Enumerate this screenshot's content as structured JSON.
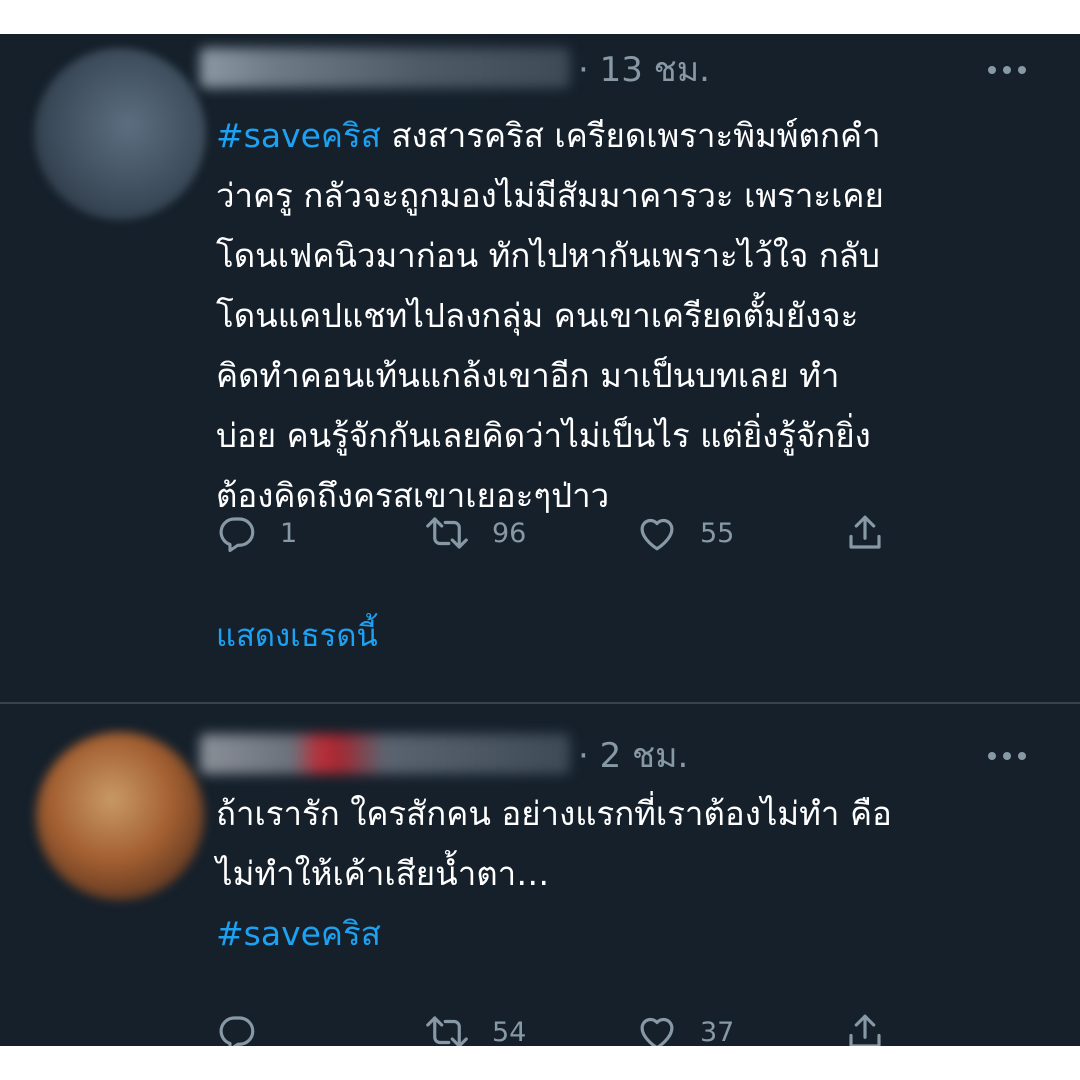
{
  "colors": {
    "background": "#15202b",
    "divider": "#38444d",
    "text_primary": "#ffffff",
    "text_secondary": "#8899a6",
    "link": "#1da1f2"
  },
  "tweets": [
    {
      "timestamp": "· 13 ชม.",
      "hashtag": "#saveคริส",
      "text": " สงสารคริส เครียดเพราะพิมพ์ตกคำ\nว่าครู กลัวจะถูกมองไม่มีสัมมาคารวะ เพราะเคย\nโดนเฟคนิวมาก่อน ทักไปหากันเพราะไว้ใจ กลับ\nโดนแคปแชทไปลงกลุ่ม คนเขาเครียดตั้มยังจะ\nคิดทำคอนเท้นแกล้งเขาอีก มาเป็นบทเลย ทำ\nบ่อย คนรู้จักกันเลยคิดว่าไม่เป็นไร แต่ยิ่งรู้จักยิ่ง\nต้องคิดถึงครสเขาเยอะๆป่าว",
      "counts": {
        "replies": "1",
        "retweets": "96",
        "likes": "55"
      },
      "show_thread": "แสดงเธรดนี้",
      "icons": [
        "reply-icon",
        "retweet-icon",
        "like-icon",
        "share-icon",
        "more-icon"
      ]
    },
    {
      "timestamp": "· 2 ชม.",
      "text": "ถ้าเรารัก ใครสักคน อย่างแรกที่เราต้องไม่ทำ คือ\nไม่ทำให้เค้าเสียน้ำตา…",
      "hashtag": "#saveคริส",
      "counts": {
        "replies": "",
        "retweets": "54",
        "likes": "37"
      },
      "icons": [
        "reply-icon",
        "retweet-icon",
        "like-icon",
        "share-icon",
        "more-icon"
      ]
    }
  ]
}
